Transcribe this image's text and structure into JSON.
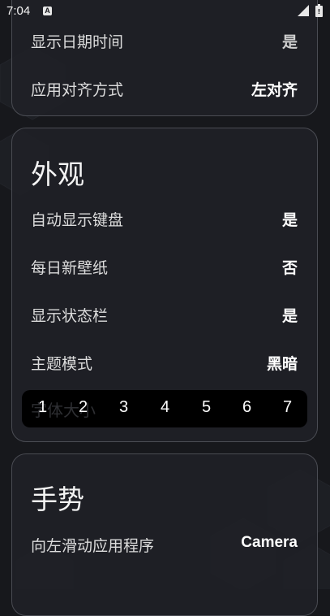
{
  "status_bar": {
    "time": "7:04",
    "notification_icon": "A",
    "signal_icon": "signal-icon",
    "battery_icon": "battery-icon"
  },
  "display_section": {
    "rows": [
      {
        "label": "显示日期时间",
        "value": "是"
      },
      {
        "label": "应用对齐方式",
        "value": "左对齐"
      }
    ]
  },
  "appearance_section": {
    "title": "外观",
    "rows": [
      {
        "label": "自动显示键盘",
        "value": "是"
      },
      {
        "label": "每日新壁纸",
        "value": "否"
      },
      {
        "label": "显示状态栏",
        "value": "是"
      },
      {
        "label": "主题模式",
        "value": "黑暗"
      }
    ],
    "font_size": {
      "label": "字体大小",
      "options": [
        "1",
        "2",
        "3",
        "4",
        "5",
        "6",
        "7"
      ]
    }
  },
  "gestures_section": {
    "title": "手势",
    "rows": [
      {
        "label": "向左滑动应用程序",
        "value": "Camera"
      }
    ]
  },
  "colors": {
    "background": "#17181c",
    "card": "#202126",
    "card_border": "#4a4c53",
    "picker": "#000000"
  }
}
